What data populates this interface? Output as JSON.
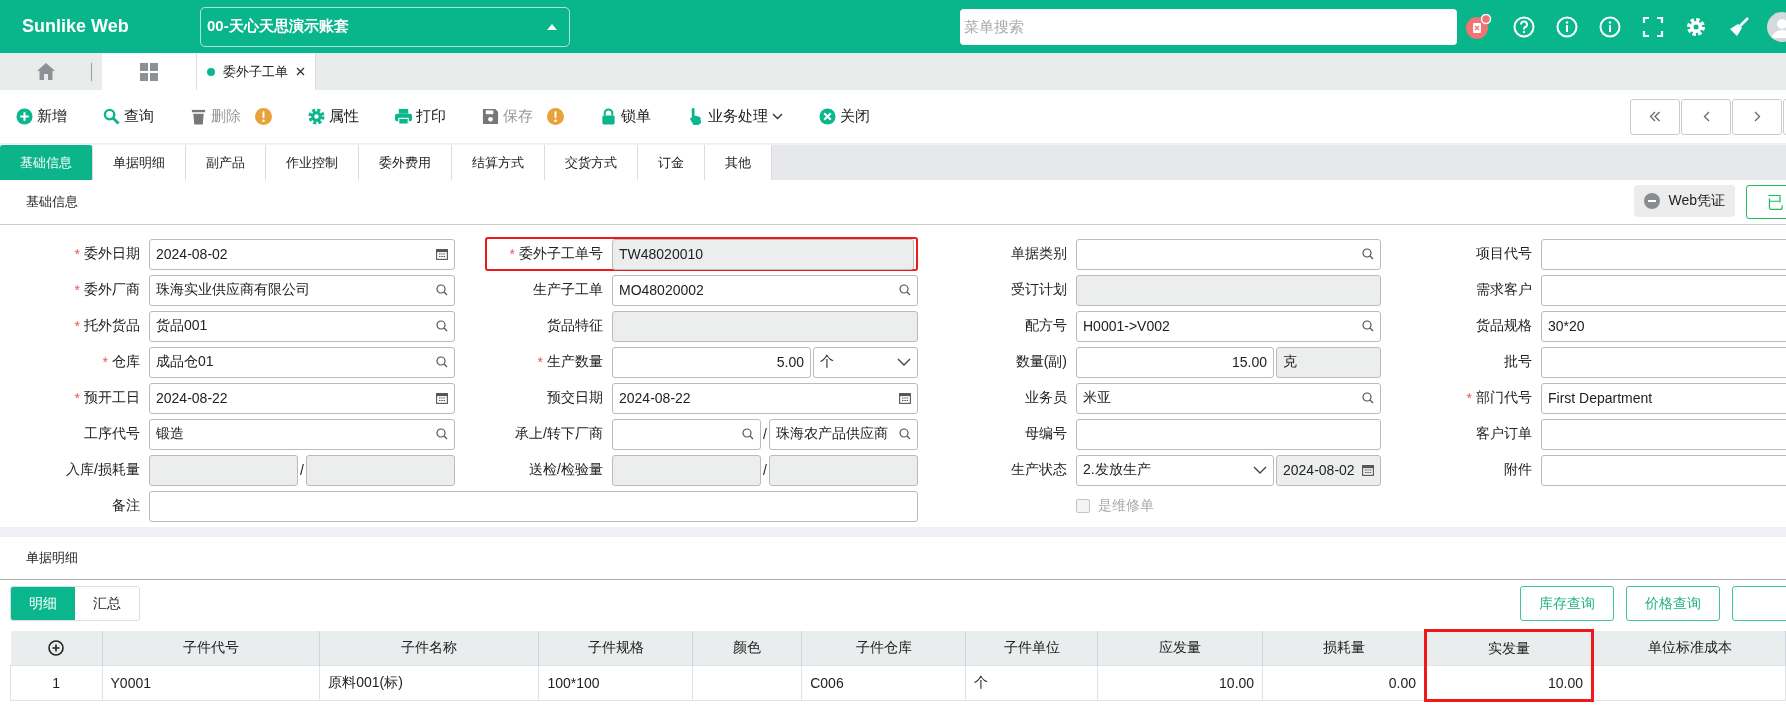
{
  "header": {
    "logo": "Sunlike Web",
    "account": "00-天心天思演示账套",
    "search": {
      "placeholder": "菜单搜索"
    },
    "notification": true
  },
  "page_tabs": [
    {
      "kind": "home",
      "selected": false
    },
    {
      "kind": "grid",
      "selected": true
    },
    {
      "kind": "doc",
      "label": "委外子工单",
      "selected": true
    }
  ],
  "toolbar": [
    {
      "label": "新增",
      "disabled": false,
      "warning": false,
      "dropdown": false
    },
    {
      "label": "查询",
      "disabled": false,
      "warning": false,
      "dropdown": false
    },
    {
      "label": "删除",
      "disabled": true,
      "warning": true,
      "dropdown": false
    },
    {
      "label": "属性",
      "disabled": false,
      "warning": false,
      "dropdown": false
    },
    {
      "label": "打印",
      "disabled": false,
      "warning": false,
      "dropdown": false
    },
    {
      "label": "保存",
      "disabled": true,
      "warning": true,
      "dropdown": false
    },
    {
      "label": "锁单",
      "disabled": false,
      "warning": false,
      "dropdown": false
    },
    {
      "label": "业务处理",
      "disabled": false,
      "warning": false,
      "dropdown": true
    },
    {
      "label": "关闭",
      "disabled": false,
      "warning": false,
      "dropdown": false
    }
  ],
  "form_tabs": [
    {
      "label": "基础信息",
      "selected": true
    },
    {
      "label": "单据明细",
      "selected": false
    },
    {
      "label": "副产品",
      "selected": false
    },
    {
      "label": "作业控制",
      "selected": false
    },
    {
      "label": "委外费用",
      "selected": false
    },
    {
      "label": "结算方式",
      "selected": false
    },
    {
      "label": "交货方式",
      "selected": false
    },
    {
      "label": "订金",
      "selected": false
    },
    {
      "label": "其他",
      "selected": false
    }
  ],
  "basic_section": {
    "title": "基础信息",
    "buttons": [
      {
        "kind": "voucher",
        "label": "Web凭证"
      },
      {
        "kind": "status",
        "label": "已"
      }
    ]
  },
  "fields": [
    {
      "kind": "field",
      "mark": "*",
      "label": "委外日期",
      "parts": [
        {
          "kind": "date",
          "value": "2024-08-02",
          "disabled": false
        }
      ]
    },
    {
      "kind": "field",
      "mark": "*",
      "label": "委外子工单号",
      "highlighted": true,
      "parts": [
        {
          "kind": "text",
          "value": "TW48020010",
          "disabled": true
        }
      ]
    },
    {
      "kind": "field",
      "label": "单据类别",
      "parts": [
        {
          "kind": "search",
          "disabled": false
        }
      ]
    },
    {
      "kind": "field",
      "label": "项目代号",
      "parts": [
        {
          "kind": "text",
          "disabled": false
        }
      ]
    },
    {
      "kind": "field",
      "mark": "*",
      "label": "委外厂商",
      "parts": [
        {
          "kind": "search",
          "value": "珠海实业供应商有限公司",
          "disabled": false
        }
      ]
    },
    {
      "kind": "field",
      "label": "生产子工单",
      "parts": [
        {
          "kind": "search",
          "value": "MO48020002",
          "disabled": false
        }
      ]
    },
    {
      "kind": "field",
      "label": "受订计划",
      "parts": [
        {
          "kind": "text",
          "disabled": true
        }
      ]
    },
    {
      "kind": "field",
      "label": "需求客户",
      "parts": [
        {
          "kind": "text",
          "disabled": false
        }
      ]
    },
    {
      "kind": "field",
      "mark": "*",
      "label": "托外货品",
      "parts": [
        {
          "kind": "search",
          "value": "货品001",
          "disabled": false
        }
      ]
    },
    {
      "kind": "field",
      "label": "货品特征",
      "parts": [
        {
          "kind": "text",
          "disabled": true
        }
      ]
    },
    {
      "kind": "field",
      "label": "配方号",
      "parts": [
        {
          "kind": "search",
          "value": "H0001->V002",
          "disabled": false
        }
      ]
    },
    {
      "kind": "field",
      "label": "货品规格",
      "parts": [
        {
          "kind": "text",
          "value": "30*20",
          "disabled": false
        }
      ]
    },
    {
      "kind": "field",
      "mark": "*",
      "label": "仓库",
      "parts": [
        {
          "kind": "search",
          "value": "成品仓01",
          "disabled": false
        }
      ]
    },
    {
      "kind": "field",
      "mark": "*",
      "label": "生产数量",
      "parts": [
        {
          "kind": "number",
          "value": "5.00",
          "disabled": false
        },
        {
          "kind": "select",
          "value": "个",
          "disabled": false
        }
      ]
    },
    {
      "kind": "field",
      "label": "数量(副)",
      "parts": [
        {
          "kind": "number",
          "value": "15.00",
          "disabled": false
        },
        {
          "kind": "text",
          "value": "克",
          "disabled": true
        }
      ]
    },
    {
      "kind": "field",
      "label": "批号",
      "parts": [
        {
          "kind": "text",
          "disabled": false
        }
      ]
    },
    {
      "kind": "field",
      "mark": "*",
      "label": "预开工日",
      "parts": [
        {
          "kind": "date",
          "value": "2024-08-22",
          "disabled": false
        }
      ]
    },
    {
      "kind": "field",
      "label": "预交日期",
      "parts": [
        {
          "kind": "date",
          "value": "2024-08-22",
          "disabled": false
        }
      ]
    },
    {
      "kind": "field",
      "label": "业务员",
      "parts": [
        {
          "kind": "search",
          "value": "米亚",
          "disabled": false
        }
      ]
    },
    {
      "kind": "field",
      "mark": "*",
      "label": "部门代号",
      "parts": [
        {
          "kind": "text",
          "value": "First Department",
          "disabled": false
        }
      ]
    },
    {
      "kind": "field",
      "label": "工序代号",
      "parts": [
        {
          "kind": "search",
          "value": "锻造",
          "disabled": false
        }
      ]
    },
    {
      "kind": "field",
      "label": "承上/转下厂商",
      "separator": "/",
      "parts": [
        {
          "kind": "search",
          "disabled": false
        },
        {
          "kind": "search",
          "value": "珠海农产品供应商",
          "disabled": false
        }
      ]
    },
    {
      "kind": "field",
      "label": "母编号",
      "parts": [
        {
          "kind": "text",
          "disabled": false
        }
      ]
    },
    {
      "kind": "field",
      "label": "客户订单",
      "parts": [
        {
          "kind": "text",
          "disabled": false
        }
      ]
    },
    {
      "kind": "field",
      "label": "入库/损耗量",
      "separator": "/",
      "parts": [
        {
          "kind": "text",
          "disabled": true
        },
        {
          "kind": "text",
          "disabled": true
        }
      ]
    },
    {
      "kind": "field",
      "label": "送检/检验量",
      "separator": "/",
      "parts": [
        {
          "kind": "text",
          "disabled": true
        },
        {
          "kind": "text",
          "disabled": true
        }
      ]
    },
    {
      "kind": "field",
      "label": "生产状态",
      "parts": [
        {
          "kind": "select",
          "value": "2.发放生产",
          "disabled": false
        },
        {
          "kind": "date",
          "value": "2024-08-02",
          "disabled": true
        }
      ]
    },
    {
      "kind": "field",
      "label": "附件",
      "parts": [
        {
          "kind": "text",
          "disabled": false
        }
      ]
    },
    {
      "kind": "field",
      "label": "备注",
      "wide": true,
      "parts": [
        {
          "kind": "text",
          "disabled": false
        }
      ]
    },
    {
      "kind": "checkbox",
      "label": "是维修单",
      "checked": false,
      "disabled": true
    }
  ],
  "detail_section": {
    "title": "单据明细",
    "views": [
      {
        "label": "明细",
        "selected": true
      },
      {
        "label": "汇总",
        "selected": false
      }
    ],
    "buttons": [
      "库存查询",
      "价格查询"
    ]
  },
  "table": {
    "columns": [
      {
        "label": "子件代号",
        "kind": "text"
      },
      {
        "label": "子件名称",
        "kind": "text"
      },
      {
        "label": "子件规格",
        "kind": "text"
      },
      {
        "label": "颜色",
        "kind": "text"
      },
      {
        "label": "子件仓库",
        "kind": "text"
      },
      {
        "label": "子件单位",
        "kind": "text"
      },
      {
        "label": "应发量",
        "kind": "number"
      },
      {
        "label": "损耗量",
        "kind": "number"
      },
      {
        "label": "实发量",
        "kind": "number",
        "highlighted": true
      },
      {
        "label": "单位标准成本",
        "kind": "number"
      }
    ],
    "rows": [
      {
        "number": "1",
        "cells": [
          "Y0001",
          "原料001(标)",
          "100*100",
          null,
          "C006",
          "个",
          "10.00",
          "0.00",
          "10.00",
          null
        ]
      }
    ]
  }
}
